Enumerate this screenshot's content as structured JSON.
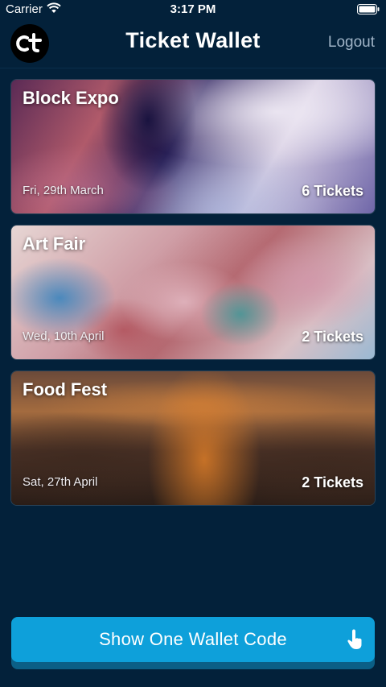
{
  "status_bar": {
    "carrier": "Carrier",
    "time": "3:17 PM"
  },
  "nav": {
    "title": "Ticket Wallet",
    "logout_label": "Logout",
    "logo_text": "Ct"
  },
  "events": [
    {
      "name": "Block Expo",
      "date": "Fri, 29th March",
      "tickets": "6 Tickets"
    },
    {
      "name": "Art Fair",
      "date": "Wed, 10th April",
      "tickets": "2 Tickets"
    },
    {
      "name": "Food Fest",
      "date": "Sat, 27th April",
      "tickets": "2 Tickets"
    }
  ],
  "wallet_button": {
    "label": "Show One Wallet Code",
    "icon": "touch-icon"
  },
  "colors": {
    "background": "#03213a",
    "button": "#0ea0da",
    "logout": "#9fb3c6"
  }
}
